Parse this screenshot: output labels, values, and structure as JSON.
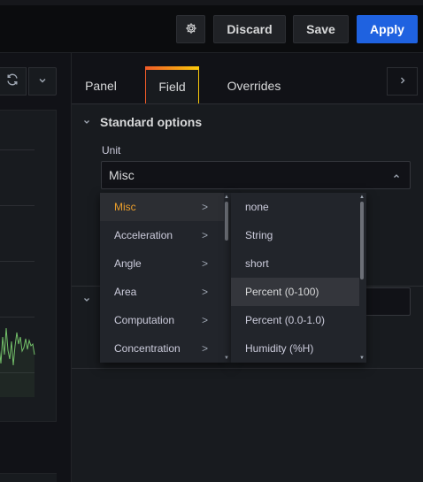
{
  "toolbar": {
    "settings_icon": "gear-icon",
    "discard_label": "Discard",
    "save_label": "Save",
    "apply_label": "Apply",
    "apply_color": "#1f62e0"
  },
  "left_panel": {
    "refresh_icon": "refresh-icon",
    "dropdown_icon": "chevron-down-icon"
  },
  "tabs": [
    {
      "label": "Panel",
      "active": false
    },
    {
      "label": "Field",
      "active": true
    },
    {
      "label": "Overrides",
      "active": false
    }
  ],
  "collapse_icon": "chevron-right-icon",
  "standard_options": {
    "title": "Standard options",
    "unit_label": "Unit",
    "unit_value": "Misc"
  },
  "unit_categories": [
    {
      "label": "Misc",
      "active": true
    },
    {
      "label": "Acceleration"
    },
    {
      "label": "Angle"
    },
    {
      "label": "Area"
    },
    {
      "label": "Computation"
    },
    {
      "label": "Concentration"
    }
  ],
  "unit_options": [
    {
      "label": "none"
    },
    {
      "label": "String"
    },
    {
      "label": "short"
    },
    {
      "label": "Percent (0-100)",
      "hover": true
    },
    {
      "label": "Percent (0.0-1.0)"
    },
    {
      "label": "Humidity (%H)"
    }
  ],
  "colors": {
    "accent_active": "#eb9e2b",
    "tab_gradient_start": "#f05a28",
    "tab_gradient_end": "#fbca0a"
  }
}
